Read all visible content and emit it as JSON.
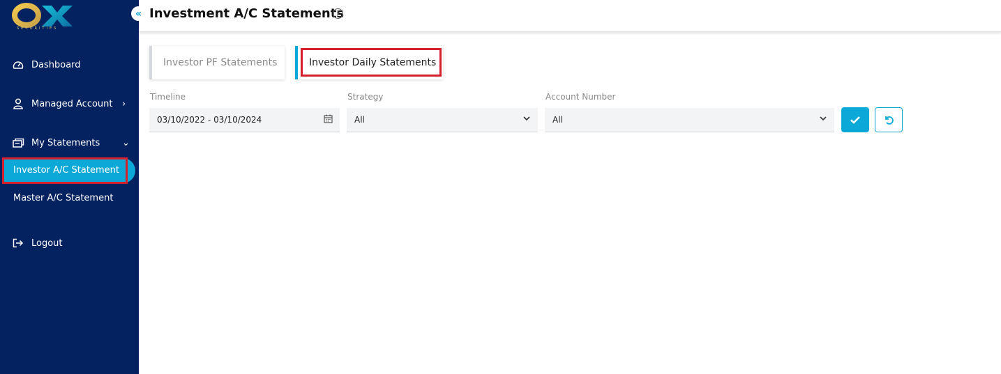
{
  "brand": {
    "logo_text": "OX",
    "logo_sub": "SECURITIES",
    "colors": {
      "sidebar": "#042160",
      "accent": "#0ba8d8",
      "highlight": "#d3202a"
    }
  },
  "sidebar": {
    "collapse_icon": "double-chevron-left-icon",
    "items": [
      {
        "label": "Dashboard",
        "icon": "dashboard-gauge-icon"
      },
      {
        "label": "Managed Account",
        "icon": "user-icon"
      },
      {
        "label": "My Statements",
        "icon": "statements-icon"
      },
      {
        "label": "Logout",
        "icon": "logout-icon"
      }
    ],
    "sub_items": [
      {
        "label": "Investor A/C Statement",
        "active": true
      },
      {
        "label": "Master A/C Statement",
        "active": false
      }
    ]
  },
  "header": {
    "title": "Investment A/C Statements",
    "info_icon": "info-icon"
  },
  "tabs": [
    {
      "label": "Investor PF Statements",
      "selected": false
    },
    {
      "label": "Investor Daily Statements",
      "selected": true
    }
  ],
  "filters": {
    "timeline": {
      "label": "Timeline",
      "value": "03/10/2022 - 03/10/2024",
      "icon": "calendar-icon"
    },
    "strategy": {
      "label": "Strategy",
      "value": "All"
    },
    "account": {
      "label": "Account Number",
      "value": "All"
    }
  },
  "actions": {
    "apply_icon": "check-icon",
    "reset_icon": "undo-icon"
  }
}
